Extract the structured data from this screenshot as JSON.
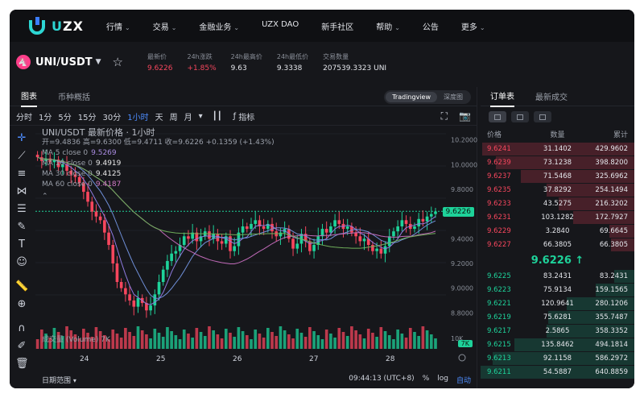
{
  "brand": {
    "name_a": "U",
    "name_b": "ZX"
  },
  "nav": [
    {
      "label": "行情",
      "chev": true
    },
    {
      "label": "交易",
      "chev": true
    },
    {
      "label": "金融业务",
      "chev": true
    },
    {
      "label": "UZX DAO",
      "chev": false
    },
    {
      "label": "新手社区",
      "chev": false
    },
    {
      "label": "帮助",
      "chev": true
    },
    {
      "label": "公告",
      "chev": false
    },
    {
      "label": "更多",
      "chev": true
    }
  ],
  "ticker": {
    "pair": "UNI/USDT",
    "stats": [
      {
        "label": "最新价",
        "value": "9.6226",
        "color": "red"
      },
      {
        "label": "24h涨跌",
        "value": "+1.85%",
        "color": "red"
      },
      {
        "label": "24h最高价",
        "value": "9.63",
        "color": ""
      },
      {
        "label": "24h最低价",
        "value": "9.3338",
        "color": ""
      },
      {
        "label": "交易数量",
        "value": "207539.3323 UNI",
        "color": ""
      }
    ]
  },
  "chart_tabs": {
    "chart": "图表",
    "overview": "币种概括",
    "tradingview": "Tradingview",
    "depth": "深度图"
  },
  "intervals": [
    "分时",
    "1分",
    "5分",
    "15分",
    "30分",
    "1小时",
    "天",
    "周",
    "月"
  ],
  "active_interval": "1小时",
  "indicator_label": "指标",
  "legend": {
    "title": "UNI/USDT 最新价格 · 1小时",
    "ohlc": "开=9.4836 高=9.6300 低=9.4711 收=9.6226 +0.1359 (+1.43%)",
    "ma": [
      {
        "label": "MA 5 close 0",
        "value": "9.5269",
        "color": "#a98be0"
      },
      {
        "label": "MA 10 close 0",
        "value": "9.4919",
        "color": "#e8e8e8"
      },
      {
        "label": "MA 30 close 0",
        "value": "9.4125",
        "color": "#e8e8e8"
      },
      {
        "label": "MA 60 close 0",
        "value": "9.4187",
        "color": "#d07bc4"
      }
    ],
    "volume": "成交量 (Volume)  7K"
  },
  "price_axis": [
    "10.2000",
    "10.0000",
    "9.8000",
    "9.4000",
    "9.2000",
    "9.0000",
    "8.8000",
    "10K"
  ],
  "current_price_label": "9.6226",
  "volume_label": "7K",
  "x_axis": [
    "24",
    "25",
    "26",
    "27",
    "28"
  ],
  "bottom": {
    "range": "日期范围",
    "time": "09:44:13 (UTC+8)",
    "pct": "%",
    "log": "log",
    "auto": "自动"
  },
  "orderbook": {
    "tab_book": "订单表",
    "tab_trades": "最新成交",
    "headers": [
      "价格",
      "数量",
      "累计"
    ],
    "asks": [
      {
        "price": "9.6241",
        "qty": "31.1402",
        "total": "429.9602",
        "depth": 0.99
      },
      {
        "price": "9.6239",
        "qty": "73.1238",
        "total": "398.8200",
        "depth": 0.9
      },
      {
        "price": "9.6237",
        "qty": "71.5468",
        "total": "325.6962",
        "depth": 0.74
      },
      {
        "price": "9.6235",
        "qty": "37.8292",
        "total": "254.1494",
        "depth": 0.57
      },
      {
        "price": "9.6233",
        "qty": "43.5275",
        "total": "216.3202",
        "depth": 0.49
      },
      {
        "price": "9.6231",
        "qty": "103.1282",
        "total": "172.7927",
        "depth": 0.4
      },
      {
        "price": "9.6229",
        "qty": "3.2840",
        "total": "69.6645",
        "depth": 0.16
      },
      {
        "price": "9.6227",
        "qty": "66.3805",
        "total": "66.3805",
        "depth": 0.15
      }
    ],
    "mid_price": "9.6226 ↑",
    "bids": [
      {
        "price": "9.6225",
        "qty": "83.2431",
        "total": "83.2431",
        "depth": 0.13
      },
      {
        "price": "9.6223",
        "qty": "75.9134",
        "total": "159.1565",
        "depth": 0.25
      },
      {
        "price": "9.6221",
        "qty": "120.9641",
        "total": "280.1206",
        "depth": 0.44
      },
      {
        "price": "9.6219",
        "qty": "75.6281",
        "total": "355.7487",
        "depth": 0.56
      },
      {
        "price": "9.6217",
        "qty": "2.5865",
        "total": "358.3352",
        "depth": 0.57
      },
      {
        "price": "9.6215",
        "qty": "135.8462",
        "total": "494.1814",
        "depth": 0.78
      },
      {
        "price": "9.6213",
        "qty": "92.1158",
        "total": "586.2972",
        "depth": 0.92
      },
      {
        "price": "9.6211",
        "qty": "54.5887",
        "total": "640.8859",
        "depth": 1.0
      }
    ]
  },
  "chart_data": {
    "type": "candlestick",
    "title": "UNI/USDT 最新价格 · 1小时",
    "x_ticks": [
      "24",
      "25",
      "26",
      "27",
      "28"
    ],
    "ylim": [
      8.75,
      10.25
    ],
    "current_price": 9.6226,
    "up_color": "#1ed29a",
    "down_color": "#f6465d",
    "closes": [
      10.06,
      10.03,
      10.05,
      10.02,
      10.04,
      9.98,
      10.0,
      9.95,
      9.92,
      9.9,
      9.85,
      9.78,
      9.7,
      9.62,
      9.58,
      9.55,
      9.45,
      9.35,
      9.2,
      9.05,
      9.0,
      8.95,
      8.9,
      8.85,
      8.92,
      8.88,
      8.82,
      8.86,
      8.95,
      9.05,
      9.15,
      9.22,
      9.28,
      9.3,
      9.35,
      9.42,
      9.4,
      9.45,
      9.38,
      9.42,
      9.46,
      9.4,
      9.44,
      9.38,
      9.36,
      9.42,
      9.3,
      9.34,
      9.45,
      9.5,
      9.48,
      9.52,
      9.55,
      9.5,
      9.48,
      9.52,
      9.46,
      9.42,
      9.45,
      9.48,
      9.4,
      9.32,
      9.36,
      9.44,
      9.38,
      9.3,
      9.35,
      9.42,
      9.48,
      9.45,
      9.5,
      9.55,
      9.52,
      9.48,
      9.5,
      9.45,
      9.42,
      9.38,
      9.4,
      9.35,
      9.3,
      9.32,
      9.28,
      9.34,
      9.42,
      9.46,
      9.5,
      9.55,
      9.52,
      9.48,
      9.5,
      9.56,
      9.54,
      9.58,
      9.6,
      9.62
    ]
  }
}
